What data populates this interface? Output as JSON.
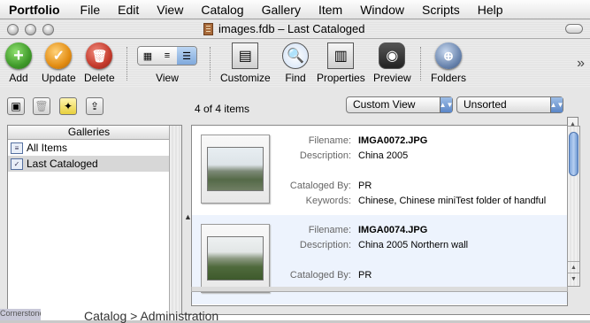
{
  "menubar": {
    "app": "Portfolio",
    "items": [
      "File",
      "Edit",
      "View",
      "Catalog",
      "Gallery",
      "Item",
      "Window",
      "Scripts",
      "Help"
    ]
  },
  "window": {
    "title": "images.fdb – Last Cataloged"
  },
  "toolbar": {
    "add": "Add",
    "update": "Update",
    "delete": "Delete",
    "view": "View",
    "customize": "Customize",
    "find": "Find",
    "properties": "Properties",
    "preview": "Preview",
    "folders": "Folders",
    "overflow": "»"
  },
  "secondary": {
    "count": "4 of 4 items",
    "view_select": "Custom View",
    "sort_select": "Unsorted"
  },
  "galleries": {
    "header": "Galleries",
    "items": [
      {
        "label": "All Items"
      },
      {
        "label": "Last Cataloged"
      }
    ]
  },
  "records": [
    {
      "filename_label": "Filename:",
      "filename": "IMGA0072.JPG",
      "description_label": "Description:",
      "description": "China 2005",
      "cataloged_by_label": "Cataloged By:",
      "cataloged_by": "PR",
      "keywords_label": "Keywords:",
      "keywords": "Chinese, Chinese miniTest folder of handful"
    },
    {
      "filename_label": "Filename:",
      "filename": "IMGA0074.JPG",
      "description_label": "Description:",
      "description": "China 2005 Northern wall",
      "cataloged_by_label": "Cataloged By:",
      "cataloged_by": "PR"
    }
  ],
  "background": {
    "left_text": "Cornerstone",
    "text": "Catalog > Administration"
  },
  "colors": {
    "add": "#3f9a2a",
    "update": "#e38d13",
    "delete": "#c43a2c",
    "selection": "#edf3fd"
  }
}
